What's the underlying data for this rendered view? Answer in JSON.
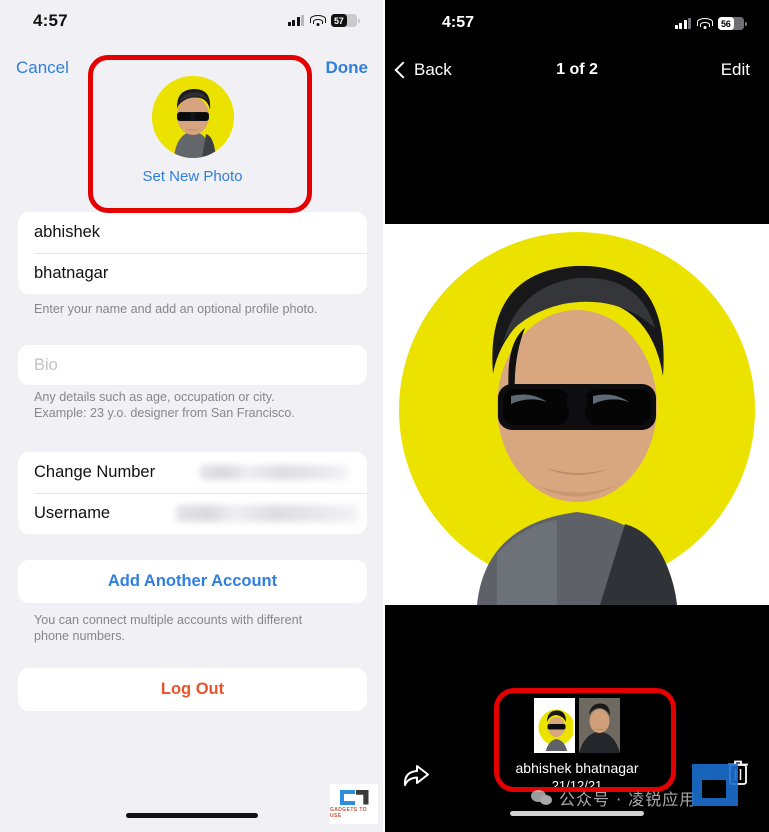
{
  "left_panel": {
    "status_bar": {
      "time": "4:57",
      "battery_level": "57",
      "cellular_icon": "cellular-bars-icon",
      "wifi_icon": "wifi-icon",
      "battery_icon": "battery-icon"
    },
    "nav": {
      "cancel_label": "Cancel",
      "done_label": "Done"
    },
    "avatar": {
      "set_new_photo_label": "Set New Photo",
      "background_color": "#ece200"
    },
    "name_fields": {
      "first_name": "abhishek",
      "last_name": "bhatnagar"
    },
    "name_helper": "Enter your name and add an optional profile photo.",
    "bio": {
      "placeholder": "Bio"
    },
    "bio_helper_line1": "Any details such as age, occupation or city.",
    "bio_helper_line2": "Example: 23 y.o. designer from San Francisco.",
    "account_rows": [
      {
        "label": "Change Number",
        "value": "",
        "value_redacted": true
      },
      {
        "label": "Username",
        "value": "",
        "value_redacted": true
      }
    ],
    "add_account_label": "Add Another Account",
    "add_account_helper_line1": "You can connect multiple accounts with different",
    "add_account_helper_line2": "phone numbers.",
    "log_out_label": "Log Out",
    "watermark": {
      "text": "GADGETS TO USE"
    }
  },
  "right_panel": {
    "status_bar": {
      "time": "4:57",
      "battery_level": "56"
    },
    "nav": {
      "back_label": "Back",
      "counter_label": "1 of 2",
      "edit_label": "Edit"
    },
    "filmstrip": {
      "name": "abhishek bhatnagar",
      "date": "21/12/21",
      "thumbnails": [
        {
          "selected": true,
          "kind": "yellow-avatar"
        },
        {
          "selected": false,
          "kind": "photo"
        }
      ]
    },
    "share_icon": "share-arrow-icon",
    "delete_icon": "trash-icon",
    "watermark": {
      "wechat_text": "公众号 · 凌锐应用"
    }
  },
  "annotations": {
    "highlight_color": "#e40000",
    "boxes": [
      {
        "name": "avatar-highlight"
      },
      {
        "name": "filmstrip-highlight"
      }
    ]
  }
}
